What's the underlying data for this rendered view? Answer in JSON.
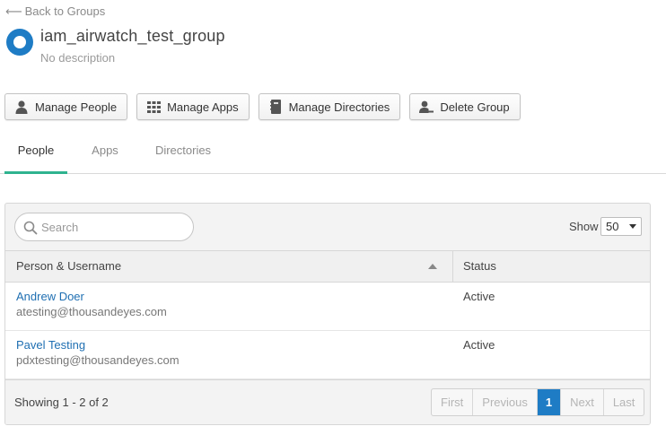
{
  "nav": {
    "back_arrow": "⟵",
    "back_label": "Back to Groups"
  },
  "group": {
    "name": "iam_airwatch_test_group",
    "description": "No description",
    "logo_color": "#1e7cc5"
  },
  "actions": [
    {
      "label": "Manage People",
      "icon": "person-icon"
    },
    {
      "label": "Manage Apps",
      "icon": "grid-icon"
    },
    {
      "label": "Manage Directories",
      "icon": "directory-icon"
    },
    {
      "label": "Delete Group",
      "icon": "person-remove-icon"
    }
  ],
  "tabs": [
    {
      "label": "People",
      "active": true
    },
    {
      "label": "Apps",
      "active": false
    },
    {
      "label": "Directories",
      "active": false
    }
  ],
  "table": {
    "search_placeholder": "Search",
    "show_label": "Show",
    "page_size": "50",
    "columns": [
      "Person & Username",
      "Status"
    ],
    "rows": [
      {
        "name": "Andrew Doer",
        "username": "atesting@thousandeyes.com",
        "status": "Active"
      },
      {
        "name": "Pavel Testing",
        "username": "pdxtesting@thousandeyes.com",
        "status": "Active"
      }
    ],
    "summary": "Showing 1 - 2 of 2",
    "pagination": {
      "first": "First",
      "previous": "Previous",
      "current": "1",
      "next": "Next",
      "last": "Last"
    }
  },
  "colors": {
    "accent": "#1e7cc5",
    "tab_underline": "#2fb38f",
    "link": "#1f6fb2"
  }
}
